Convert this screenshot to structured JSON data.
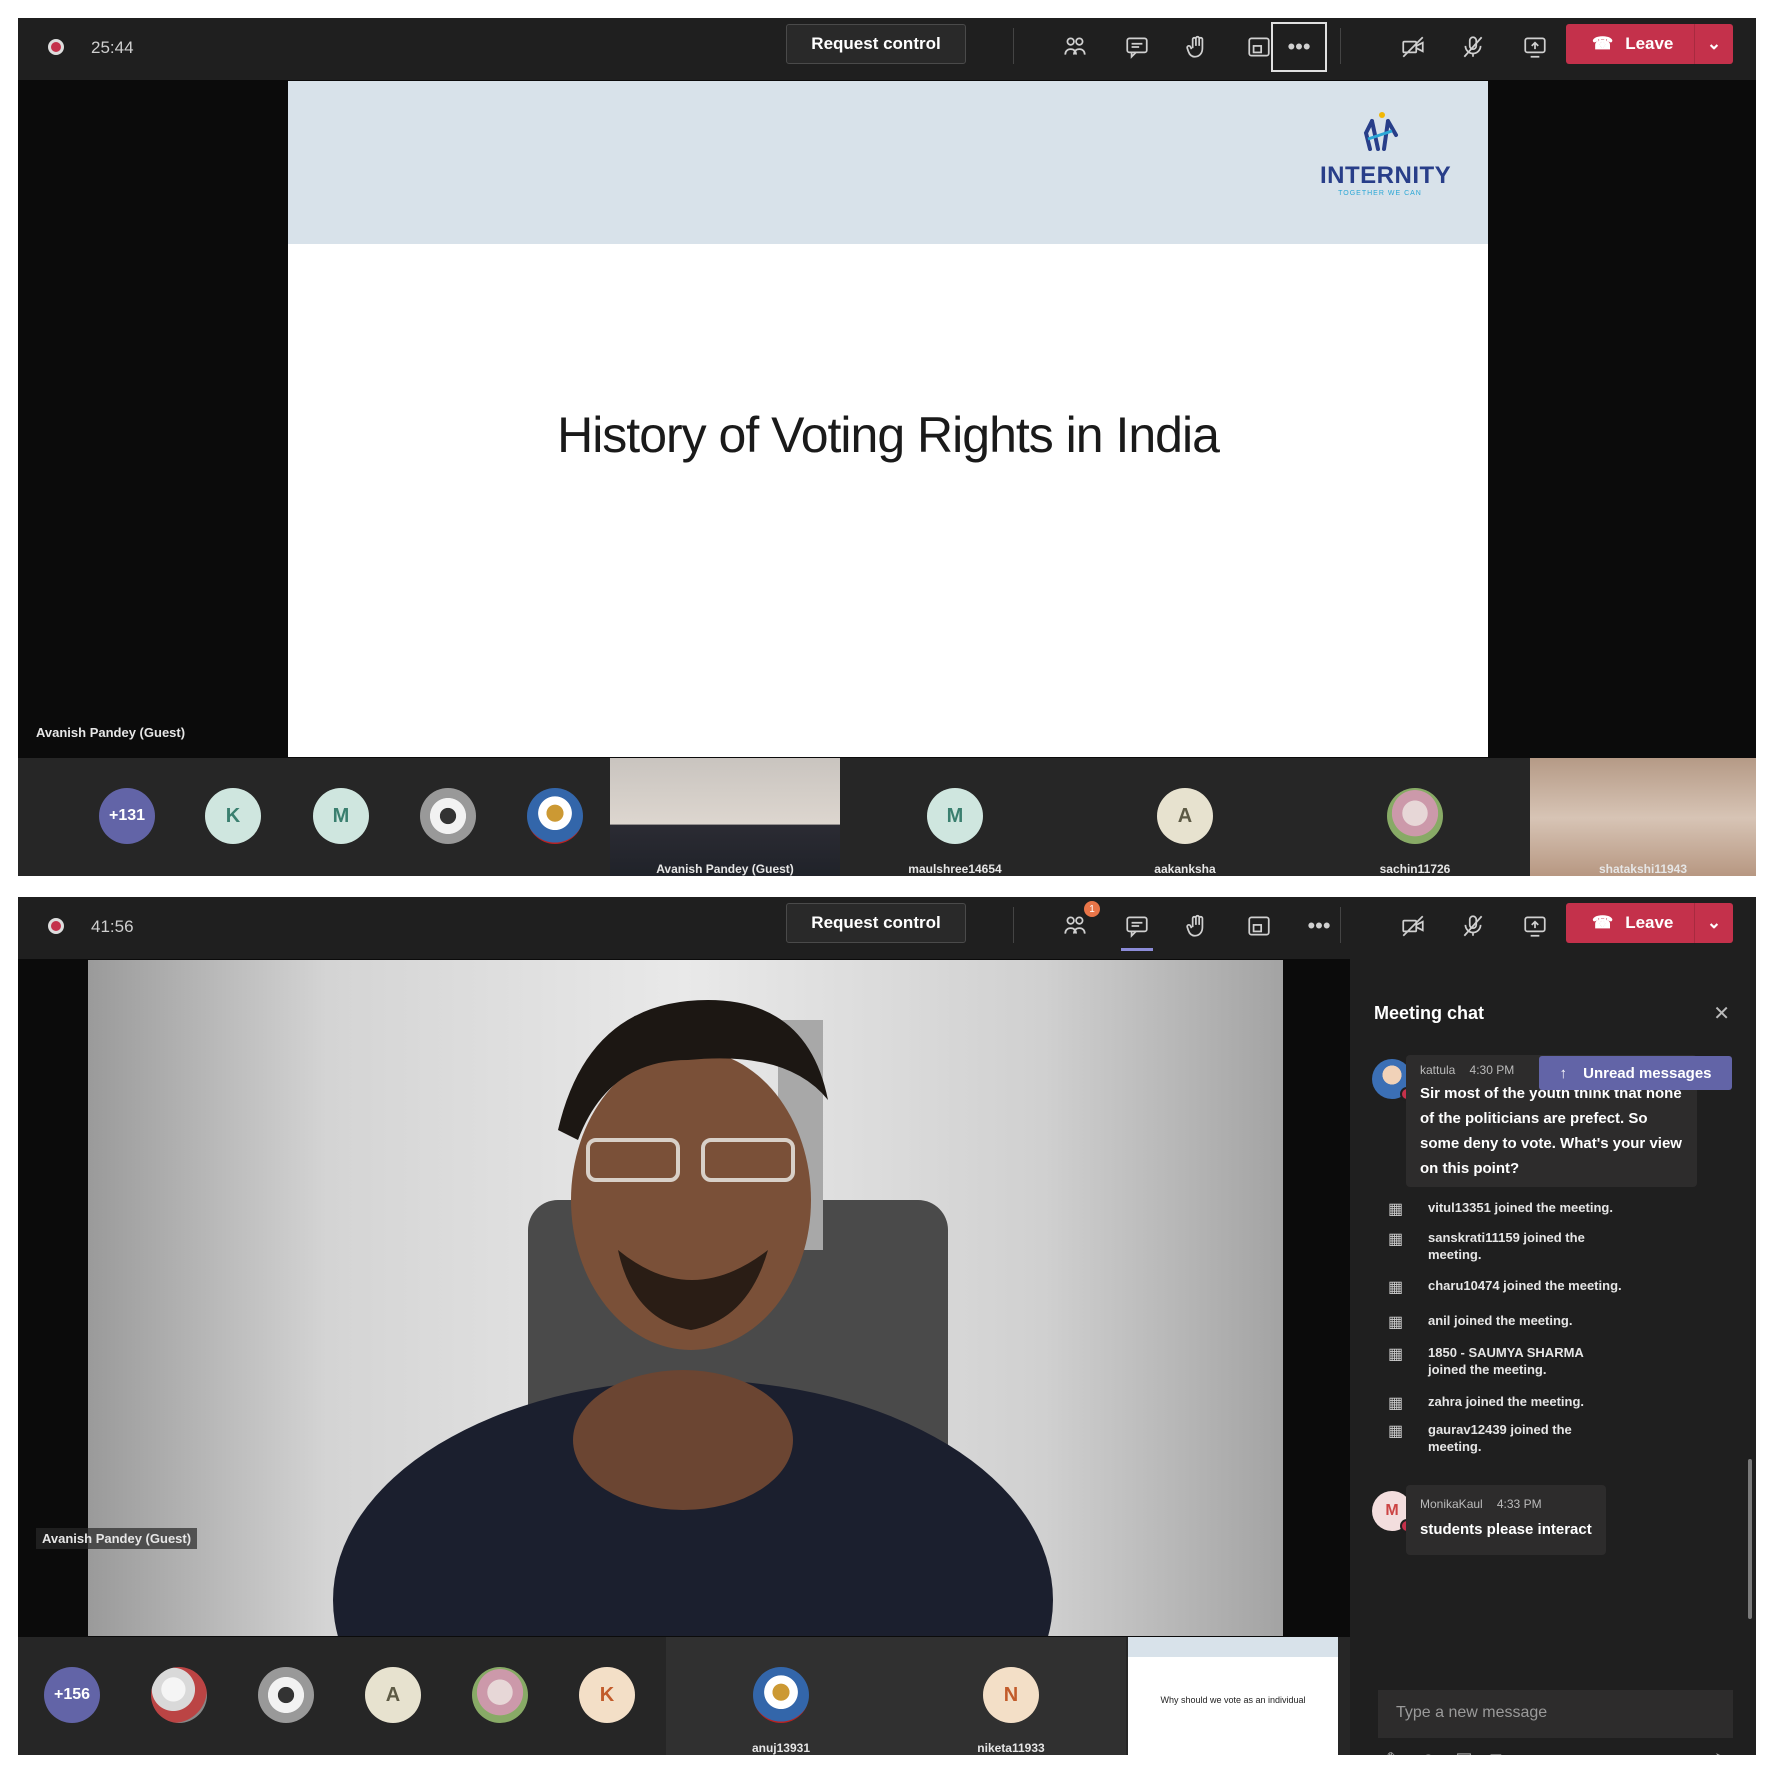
{
  "screen1": {
    "timer": "25:44",
    "request_control": "Request control",
    "leave": "Leave",
    "slide": {
      "logo_name": "INTERNITY",
      "logo_tagline": "TOGETHER WE CAN",
      "title": "History of Voting Rights in India"
    },
    "presenter_label": "Avanish Pandey (Guest)",
    "strip": {
      "more_count": "+131",
      "avatars": [
        "K",
        "M"
      ],
      "tiles": [
        {
          "name": "Avanish Pandey (Guest)"
        },
        {
          "initial": "M",
          "name": "maulshree14654"
        },
        {
          "initial": "A",
          "name": "aakanksha"
        },
        {
          "name": "sachin11726"
        },
        {
          "name": "shatakshi11943"
        }
      ]
    }
  },
  "screen2": {
    "timer": "41:56",
    "request_control": "Request control",
    "leave": "Leave",
    "people_badge": "1",
    "presenter_label": "Avanish Pandey (Guest)",
    "strip": {
      "more_count": "+156",
      "avatars": [
        "A",
        "K"
      ],
      "tiles": [
        {
          "name": "anuj13931"
        },
        {
          "initial": "N",
          "name": "niketa11933"
        }
      ],
      "mini_slide_text": "Why should we vote as an individual"
    },
    "chat": {
      "title": "Meeting chat",
      "unread": "Unread messages",
      "messages": [
        {
          "author": "kattula",
          "time": "4:30 PM",
          "text": "Sir most of the youth think that none of the politicians are prefect. So some deny to vote. What's your view on this point?"
        }
      ],
      "system": [
        "vitul13351 joined the meeting.",
        "sanskrati11159 joined the meeting.",
        "charu10474 joined the meeting.",
        "anil joined the meeting.",
        "1850 - SAUMYA SHARMA joined the meeting.",
        "zahra joined the meeting.",
        "gaurav12439 joined the meeting."
      ],
      "last_message": {
        "initial": "M",
        "author": "MonikaKaul",
        "time": "4:33 PM",
        "text": "students please interact"
      },
      "compose_placeholder": "Type a new message"
    }
  },
  "colors": {
    "leave": "#c4314b",
    "accent": "#6264a7",
    "toolbar": "#1f1f1f",
    "slide_header": "#d8e2ea"
  }
}
